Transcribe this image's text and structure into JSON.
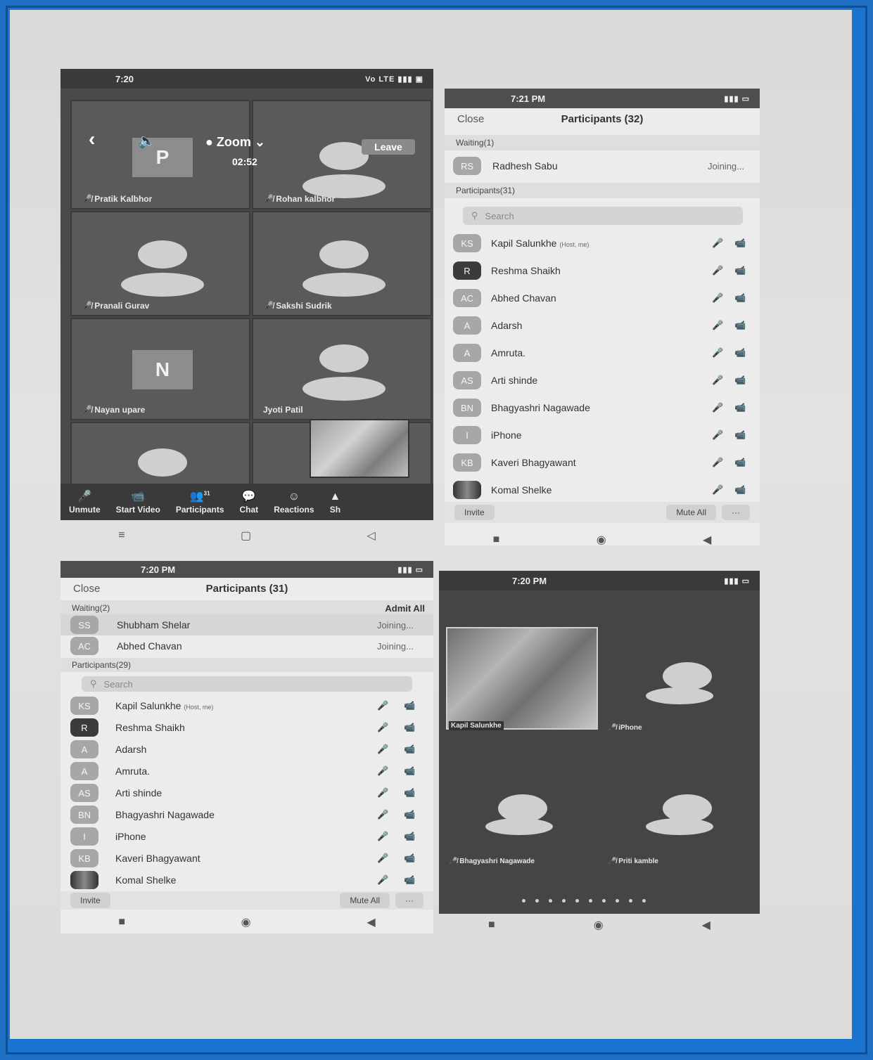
{
  "meeting": {
    "status_time": "7:20",
    "status_right": "Vo LTE ▮▮▮ ▣",
    "app_title": "Zoom",
    "timer": "02:52",
    "leave_label": "Leave",
    "tiles": [
      {
        "name": "Pratik Kalbhor",
        "letter": "P"
      },
      {
        "name": "Rohan kalbhor",
        "letter": ""
      },
      {
        "name": "Pranali Gurav",
        "letter": ""
      },
      {
        "name": "Sakshi Sudrik",
        "letter": ""
      },
      {
        "name": "Nayan upare",
        "letter": "N"
      },
      {
        "name": "Jyoti Patil",
        "letter": ""
      }
    ],
    "toolbar": {
      "unmute": "Unmute",
      "start_video": "Start Video",
      "participants": "Participants",
      "participants_count": "31",
      "chat": "Chat",
      "reactions": "Reactions",
      "share": "Sh"
    }
  },
  "plist_right": {
    "status_time": "7:21 PM",
    "close": "Close",
    "title": "Participants (32)",
    "waiting_header": "Waiting(1)",
    "waiting": [
      {
        "initials": "RS",
        "name": "Radhesh Sabu",
        "status": "Joining..."
      }
    ],
    "participants_header": "Participants(31)",
    "search_placeholder": "Search",
    "rows": [
      {
        "initials": "KS",
        "name": "Kapil Salunkhe",
        "tag": "(Host, me)",
        "style": "light"
      },
      {
        "initials": "R",
        "name": "Reshma Shaikh",
        "tag": "",
        "style": "dark"
      },
      {
        "initials": "AC",
        "name": "Abhed Chavan",
        "tag": "",
        "style": "light"
      },
      {
        "initials": "A",
        "name": "Adarsh",
        "tag": "",
        "style": "light"
      },
      {
        "initials": "A",
        "name": "Amruta.",
        "tag": "",
        "style": "light"
      },
      {
        "initials": "AS",
        "name": "Arti shinde",
        "tag": "",
        "style": "light"
      },
      {
        "initials": "BN",
        "name": "Bhagyashri Nagawade",
        "tag": "",
        "style": "light"
      },
      {
        "initials": "I",
        "name": "iPhone",
        "tag": "",
        "style": "light"
      },
      {
        "initials": "KB",
        "name": "Kaveri Bhagyawant",
        "tag": "",
        "style": "light"
      },
      {
        "initials": "",
        "name": "Komal Shelke",
        "tag": "",
        "style": "pic"
      }
    ],
    "invite": "Invite",
    "mute_all": "Mute All",
    "more": "···"
  },
  "plist_left": {
    "status_time": "7:20 PM",
    "close": "Close",
    "title": "Participants (31)",
    "waiting_header": "Waiting(2)",
    "admit_all": "Admit All",
    "waiting": [
      {
        "initials": "SS",
        "name": "Shubham Shelar",
        "status": "Joining..."
      },
      {
        "initials": "AC",
        "name": "Abhed Chavan",
        "status": "Joining..."
      }
    ],
    "participants_header": "Participants(29)",
    "search_placeholder": "Search",
    "rows": [
      {
        "initials": "KS",
        "name": "Kapil Salunkhe",
        "tag": "(Host, me)",
        "style": "light"
      },
      {
        "initials": "R",
        "name": "Reshma Shaikh",
        "tag": "",
        "style": "dark"
      },
      {
        "initials": "A",
        "name": "Adarsh",
        "tag": "",
        "style": "light"
      },
      {
        "initials": "A",
        "name": "Amruta.",
        "tag": "",
        "style": "light"
      },
      {
        "initials": "AS",
        "name": "Arti shinde",
        "tag": "",
        "style": "light"
      },
      {
        "initials": "BN",
        "name": "Bhagyashri Nagawade",
        "tag": "",
        "style": "light"
      },
      {
        "initials": "I",
        "name": "iPhone",
        "tag": "",
        "style": "light"
      },
      {
        "initials": "KB",
        "name": "Kaveri Bhagyawant",
        "tag": "",
        "style": "light"
      },
      {
        "initials": "",
        "name": "Komal Shelke",
        "tag": "",
        "style": "pic"
      }
    ],
    "invite": "Invite",
    "mute_all": "Mute All",
    "more": "···"
  },
  "meeting2": {
    "status_time": "7:20 PM",
    "self_name": "Kapil Salunkhe",
    "tiles": [
      {
        "name": "iPhone"
      },
      {
        "name": "Bhagyashri Nagawade"
      },
      {
        "name": "Priti kamble"
      }
    ]
  }
}
